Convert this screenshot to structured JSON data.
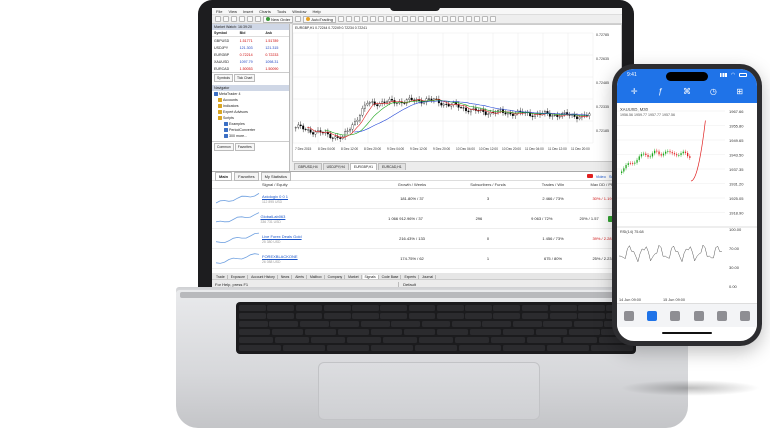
{
  "menu": [
    "File",
    "View",
    "Insert",
    "Charts",
    "Tools",
    "Window",
    "Help"
  ],
  "toolbar": {
    "new_order": "New Order",
    "autotrading": "AutoTrading"
  },
  "market_watch": {
    "title": "Market Watch: 16:39:20",
    "headers": [
      "Symbol",
      "Bid",
      "Ask"
    ],
    "rows": [
      [
        "GBPUSD",
        "1.51771",
        "1.51789"
      ],
      [
        "USDJPY",
        "121.303",
        "121.315"
      ],
      [
        "EURGBP",
        "0.72214",
        "0.72233"
      ],
      [
        "XAUUSD",
        "1097.79",
        "1098.31"
      ],
      [
        "EURCAD",
        "1.50053",
        "1.50090"
      ]
    ],
    "tabs": [
      "Symbols",
      "Tick Chart"
    ]
  },
  "navigator": {
    "title": "Navigator",
    "items": [
      "MetaTrader 4",
      "Accounts",
      "Indicators",
      "Expert Advisors",
      "Scripts",
      "Examples",
      "PeriodConverter",
      "300 more..."
    ],
    "tabs": [
      "Common",
      "Favorites"
    ]
  },
  "chart": {
    "title": "EURGBP,H1  0.72244  0.72249  0.72234  0.72241",
    "y_labels": [
      "0.72785",
      "0.72635",
      "0.72485",
      "0.72335",
      "0.72185"
    ],
    "x_labels": [
      "7 Dec 2015",
      "8 Dec 04:00",
      "8 Dec 12:00",
      "8 Dec 20:00",
      "9 Dec 04:00",
      "9 Dec 12:00",
      "9 Dec 20:00",
      "10 Dec 04:00",
      "10 Dec 12:00",
      "10 Dec 20:00",
      "11 Dec 04:00",
      "11 Dec 12:00",
      "11 Dec 20:00"
    ],
    "tabs": [
      "GBPUSD,H4",
      "USDJPY,H4",
      "EURGBP,H1",
      "EURCAD,H1"
    ],
    "active_tab": 2
  },
  "terminal": {
    "tabs": [
      "Main",
      "Favorites",
      "My Statistics"
    ],
    "video_label": "Video",
    "more_label": "Subs",
    "columns": [
      "Signal / Equity",
      "Growth / Weeks",
      "Subscribers / Funds",
      "Trades / Win",
      "Max DD / PF"
    ],
    "rows": [
      {
        "name": "Axiologix 0 0 1",
        "sub": "112 895 USD",
        "growth": "181.80% / 37",
        "subs": "3",
        "trades": "2 466 / 73%",
        "dd": "30% / 1.19",
        "dd_red": true
      },
      {
        "name": "GlobalLab063",
        "sub": "336 731 USD",
        "growth": "1 066 912.96% / 37",
        "subs": "296",
        "trades": "9 063 / 72%",
        "dd": "20% / 1.57",
        "dd_red": false
      },
      {
        "name": "Live Forex Deals Gold",
        "sub": "25 380 USD",
        "growth": "216.43% / 133",
        "subs": "0",
        "trades": "1 456 / 73%",
        "dd": "39% / 2.28",
        "dd_red": true
      },
      {
        "name": "FOREXBLACKONE",
        "sub": "26 088 USD",
        "growth": "174.75% / 62",
        "subs": "1",
        "trades": "675 / 80%",
        "dd": "25% / 2.23",
        "dd_red": false
      }
    ],
    "bottom_tabs": [
      "Trade",
      "Exposure",
      "Account History",
      "News",
      "Alerts",
      "Mailbox",
      "Company",
      "Market",
      "Signals",
      "Code Base",
      "Experts",
      "Journal"
    ],
    "active_bottom_tab": 8
  },
  "status_bar": {
    "help": "For Help, press F1",
    "profile": "Default"
  },
  "phone": {
    "time": "9:41",
    "chart_title": "XAUUSD, M30",
    "chart_sub": "1956.56 1959.77 1957.77 1957.56",
    "price_labels": [
      "1967.66",
      "1955.80",
      "1949.65",
      "1943.50",
      "1937.35",
      "1931.20",
      "1925.05",
      "1918.90"
    ],
    "indicator_label": "RSI(14) 75.68",
    "indicator_levels": [
      "100.00",
      "70.00",
      "30.00",
      "0.00"
    ],
    "x_labels": [
      "14 Jun 09:00",
      "15 Jun 09:00"
    ]
  },
  "colors": {
    "bull_candle": "#ffffff",
    "bear_candle": "#000000",
    "ma_red": "#e02020",
    "ma_green": "#1aa41a",
    "ma_blue": "#2145d6",
    "phone_accent": "#1f73e8"
  }
}
